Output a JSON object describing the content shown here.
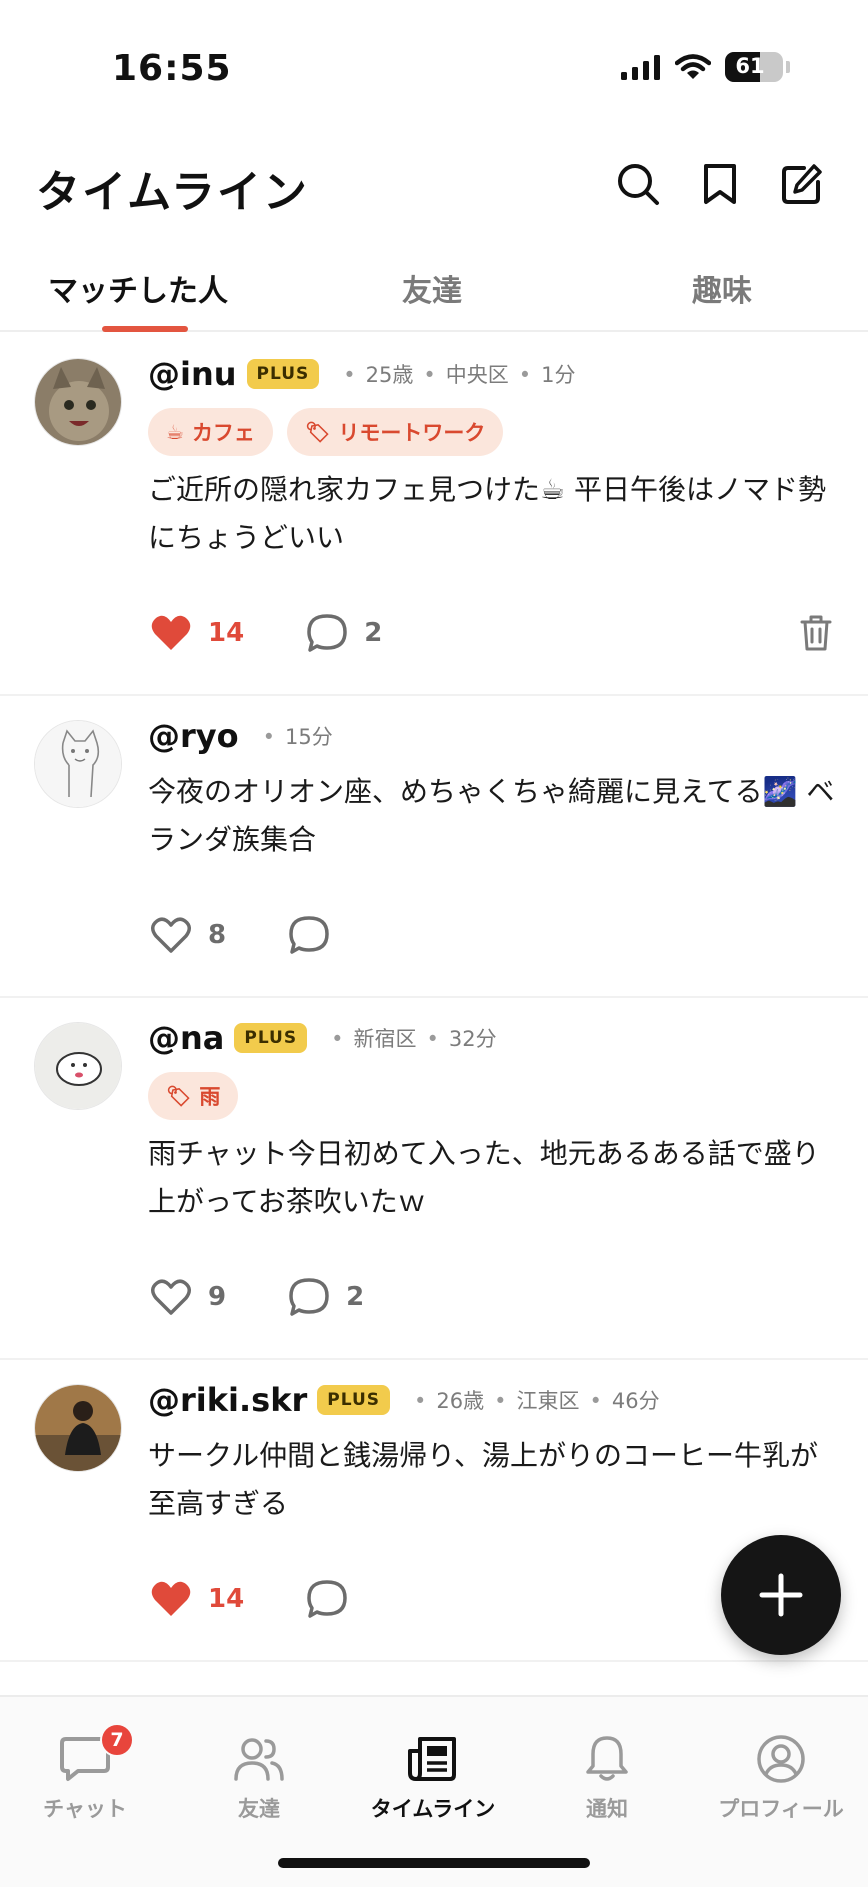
{
  "status": {
    "time": "16:55",
    "battery": "61",
    "battery_level": 0.61
  },
  "header": {
    "title": "タイムライン"
  },
  "tabs": [
    {
      "label": "マッチした人",
      "active": true
    },
    {
      "label": "友達",
      "active": false
    },
    {
      "label": "趣味",
      "active": false
    }
  ],
  "posts": [
    {
      "username": "@inu",
      "plus": "PLUS",
      "meta": [
        "25歳",
        "中央区",
        "1分"
      ],
      "tags": [
        {
          "icon": "☕",
          "label": "カフェ"
        },
        {
          "icon": "🏷",
          "label": "リモートワーク"
        }
      ],
      "text": "ご近所の隠れ家カフェ見つけた☕ 平日午後はノマド勢にちょうどいい",
      "likes": "14",
      "comments": "2",
      "liked": true,
      "deletable": true
    },
    {
      "username": "@ryo",
      "plus": "",
      "meta": [
        "15分"
      ],
      "tags": [],
      "text": "今夜のオリオン座、めちゃくちゃ綺麗に見えてる🌌 ベランダ族集合",
      "likes": "8",
      "comments": "",
      "liked": false
    },
    {
      "username": "@na",
      "plus": "PLUS",
      "meta": [
        "新宿区",
        "32分"
      ],
      "tags": [
        {
          "icon": "🏷",
          "label": "雨"
        }
      ],
      "text": "雨チャット今日初めて入った、地元あるある話で盛り上がってお茶吹いたｗ",
      "likes": "9",
      "comments": "2",
      "liked": false
    },
    {
      "username": "@riki.skr",
      "plus": "PLUS",
      "meta": [
        "26歳",
        "江東区",
        "46分"
      ],
      "tags": [],
      "text": "サークル仲間と銭湯帰り、湯上がりのコーヒー牛乳が至高すぎる",
      "likes": "14",
      "comments": "",
      "liked": true
    }
  ],
  "tabbar": [
    {
      "label": "チャット",
      "icon": "chat-bubble-icon",
      "badge": "7"
    },
    {
      "label": "友達",
      "icon": "people-icon"
    },
    {
      "label": "タイムライン",
      "icon": "newspaper-icon",
      "active": true
    },
    {
      "label": "通知",
      "icon": "bell-icon"
    },
    {
      "label": "プロフィール",
      "icon": "user-circle-icon"
    }
  ],
  "colors": {
    "accent": "#e35540",
    "like": "#e04a3a",
    "plus_badge": "#f2cb4c",
    "tag_bg": "#fbe6dc",
    "fab": "#151515"
  }
}
